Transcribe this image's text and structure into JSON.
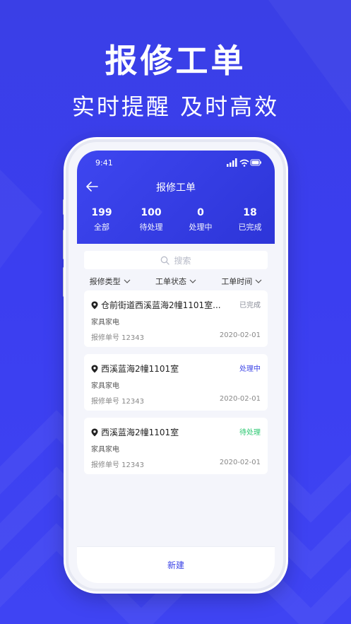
{
  "promo": {
    "title": "报修工单",
    "subtitle": "实时提醒  及时高效"
  },
  "status_bar": {
    "time": "9:41"
  },
  "header": {
    "title": "报修工单"
  },
  "stats": [
    {
      "value": "199",
      "label": "全部"
    },
    {
      "value": "100",
      "label": "待处理"
    },
    {
      "value": "0",
      "label": "处理中"
    },
    {
      "value": "18",
      "label": "已完成"
    }
  ],
  "search": {
    "placeholder": "搜索"
  },
  "filters": [
    {
      "label": "报修类型"
    },
    {
      "label": "工单状态"
    },
    {
      "label": "工单时间"
    }
  ],
  "orders": [
    {
      "address": "仓前街道西溪蓝海2幢1101室...",
      "status": "已完成",
      "status_color": "#8a8d99",
      "category": "家具家电",
      "number_label": "报修单号  12343",
      "date": "2020-02-01"
    },
    {
      "address": "西溪蓝海2幢1101室",
      "status": "处理中",
      "status_color": "#3b43e6",
      "category": "家具家电",
      "number_label": "报修单号  12343",
      "date": "2020-02-01"
    },
    {
      "address": "西溪蓝海2幢1101室",
      "status": "待处理",
      "status_color": "#28c76f",
      "category": "家具家电",
      "number_label": "报修单号  12343",
      "date": "2020-02-01"
    }
  ],
  "bottom": {
    "new_label": "新建"
  },
  "colors": {
    "accent": "#3b43e6",
    "background": "#3b3ef0"
  }
}
